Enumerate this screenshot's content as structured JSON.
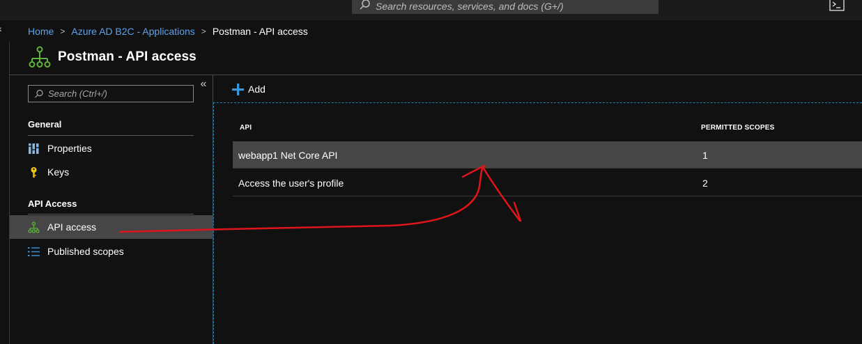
{
  "topbar": {
    "search_placeholder": "Search resources, services, and docs (G+/)"
  },
  "breadcrumb": {
    "items": [
      "Home",
      "Azure AD B2C - Applications"
    ],
    "current": "Postman - API access"
  },
  "page": {
    "title": "Postman - API access"
  },
  "sidebar": {
    "search_placeholder": "Search (Ctrl+/)",
    "collapse_icon": "«",
    "sections": [
      {
        "label": "General",
        "items": [
          {
            "label": "Properties",
            "icon": "properties-icon"
          },
          {
            "label": "Keys",
            "icon": "key-icon"
          }
        ]
      },
      {
        "label": "API Access",
        "items": [
          {
            "label": "API access",
            "icon": "api-access-icon",
            "selected": true
          },
          {
            "label": "Published scopes",
            "icon": "list-icon"
          }
        ]
      }
    ]
  },
  "toolbar": {
    "add_label": "Add"
  },
  "table": {
    "columns": [
      "API",
      "PERMITTED SCOPES"
    ],
    "rows": [
      {
        "api": "webapp1 Net Core API",
        "scopes": "1",
        "selected": true
      },
      {
        "api": "Access the user's profile",
        "scopes": "2",
        "selected": false
      }
    ]
  },
  "colors": {
    "background": "#111111",
    "link": "#5ea2ea",
    "selected_row": "#464646",
    "accent_green": "#5fb33f",
    "accent_blue": "#3a96dd",
    "annotation_red": "#e0151b"
  }
}
